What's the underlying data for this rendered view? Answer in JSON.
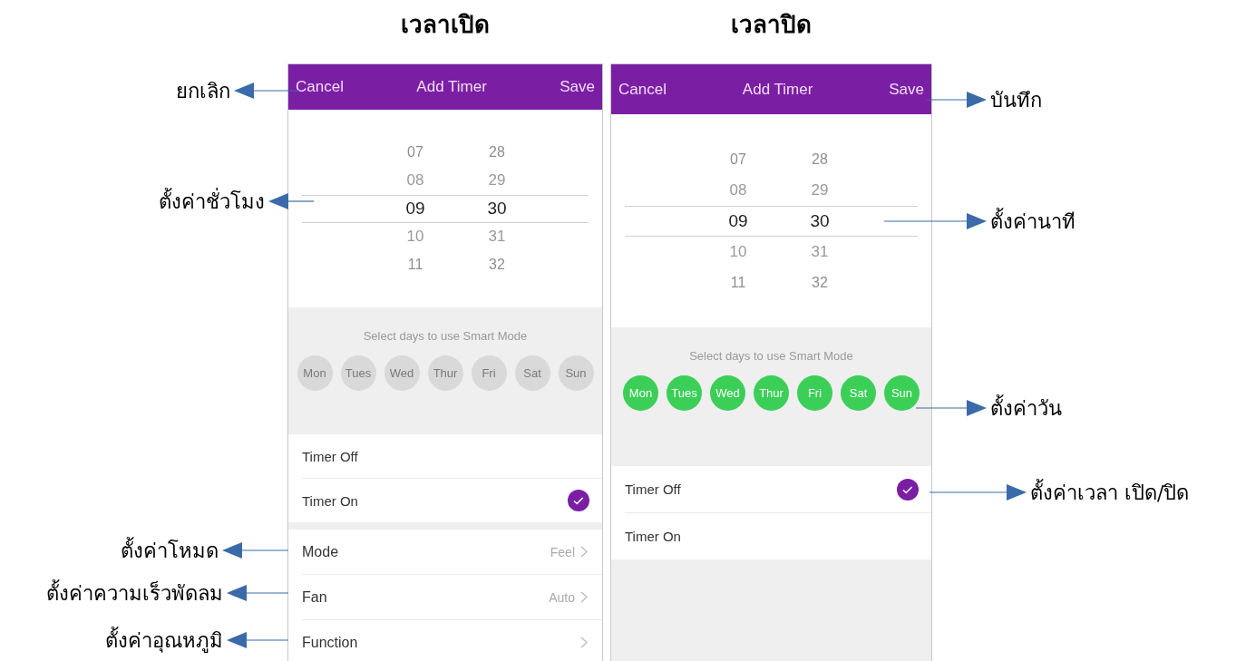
{
  "left_labels": [
    {
      "text": "ยกเลิก"
    },
    {
      "text": "ตั้งค่าชั่วโมง"
    },
    {
      "text": "ตั้งค่าโหมด"
    },
    {
      "text": "ตั้งค่าความเร็วพัดลม"
    },
    {
      "text": "ตั้งค่าอุณหภูมิ"
    }
  ],
  "screens": [
    {
      "caption": "เวลาเปิด",
      "header": {
        "cancel": "Cancel",
        "title": "Add Timer",
        "save": "Save"
      },
      "picker": [
        {
          "hour": "07",
          "minute": "28",
          "selected": false
        },
        {
          "hour": "08",
          "minute": "29",
          "selected": false
        },
        {
          "hour": "09",
          "minute": "30",
          "selected": true
        },
        {
          "hour": "10",
          "minute": "31",
          "selected": false
        },
        {
          "hour": "11",
          "minute": "32",
          "selected": false
        }
      ],
      "days_prompt": "Select days to use Smart Mode",
      "days": [
        {
          "label": "Mon",
          "selected": false
        },
        {
          "label": "Tues",
          "selected": false
        },
        {
          "label": "Wed",
          "selected": false
        },
        {
          "label": "Thur",
          "selected": false
        },
        {
          "label": "Fri",
          "selected": false
        },
        {
          "label": "Sat",
          "selected": false
        },
        {
          "label": "Sun",
          "selected": false
        }
      ],
      "timer_options": [
        {
          "label": "Timer Off",
          "selected": false
        },
        {
          "label": "Timer On",
          "selected": true
        }
      ],
      "settings": [
        {
          "label": "Mode",
          "value": "Feel"
        },
        {
          "label": "Fan",
          "value": "Auto"
        },
        {
          "label": "Function"
        }
      ]
    },
    {
      "caption": "เวลาปิด",
      "header": {
        "cancel": "Cancel",
        "title": "Add Timer",
        "save": "Save"
      },
      "picker": [
        {
          "hour": "07",
          "minute": "28",
          "selected": false
        },
        {
          "hour": "08",
          "minute": "29",
          "selected": false
        },
        {
          "hour": "09",
          "minute": "30",
          "selected": true
        },
        {
          "hour": "10",
          "minute": "31",
          "selected": false
        },
        {
          "hour": "11",
          "minute": "32",
          "selected": false
        }
      ],
      "days_prompt": "Select days to use Smart Mode",
      "days": [
        {
          "label": "Mon",
          "selected": true
        },
        {
          "label": "Tues",
          "selected": true
        },
        {
          "label": "Wed",
          "selected": true
        },
        {
          "label": "Thur",
          "selected": true
        },
        {
          "label": "Fri",
          "selected": true
        },
        {
          "label": "Sat",
          "selected": true
        },
        {
          "label": "Sun",
          "selected": true
        }
      ],
      "timer_options": [
        {
          "label": "Timer Off",
          "selected": true
        },
        {
          "label": "Timer On",
          "selected": false
        }
      ]
    }
  ],
  "right_labels": [
    {
      "text": "บันทึก"
    },
    {
      "text": "ตั้งค่านาที"
    },
    {
      "text": "ตั้งค่าวัน"
    },
    {
      "text": "ตั้งค่าเวลา เปิด/ปิด"
    }
  ]
}
